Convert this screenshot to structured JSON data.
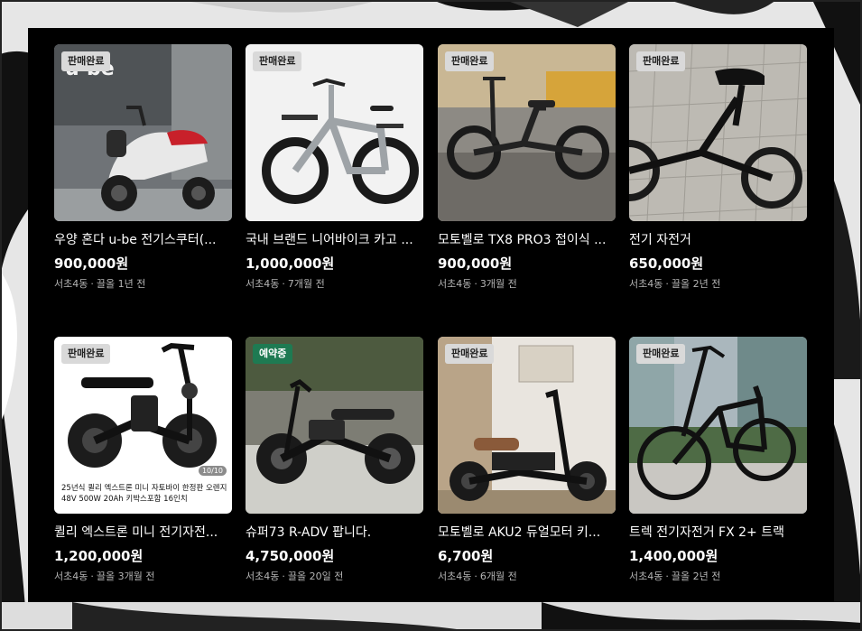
{
  "listings": [
    {
      "badge": "판매완료",
      "badge_type": "sold",
      "title": "우양 혼다 u-be 전기스쿠터(...",
      "price": "900,000원",
      "location": "서초4동",
      "time": "끌올 1년 전"
    },
    {
      "badge": "판매완료",
      "badge_type": "sold",
      "title": "국내 브랜드 니어바이크 카고 ...",
      "price": "1,000,000원",
      "location": "서초4동",
      "time": "7개월 전"
    },
    {
      "badge": "판매완료",
      "badge_type": "sold",
      "title": "모토벨로 TX8 PRO3 접이식 ...",
      "price": "900,000원",
      "location": "서초4동",
      "time": "3개월 전"
    },
    {
      "badge": "판매완료",
      "badge_type": "sold",
      "title": "전기 자전거",
      "price": "650,000원",
      "location": "서초4동",
      "time": "끌올 2년 전"
    },
    {
      "badge": "판매완료",
      "badge_type": "sold",
      "title": "퀼리 엑스트론 미니 전기자전...",
      "price": "1,200,000원",
      "location": "서초4동",
      "time": "끌올 3개월 전",
      "image_caption": "25년식 퀼리 엑스트론 미니 자토바이 한정판 오렌지 48V 500W 20Ah 키박스포함 16인치",
      "image_counter": "10/10"
    },
    {
      "badge": "예약중",
      "badge_type": "reserved",
      "title": "슈퍼73 R-ADV 팝니다.",
      "price": "4,750,000원",
      "location": "서초4동",
      "time": "끌올 20일 전"
    },
    {
      "badge": "판매완료",
      "badge_type": "sold",
      "title": "모토벨로 AKU2 듀얼모터 키...",
      "price": "6,700원",
      "location": "서초4동",
      "time": "6개월 전"
    },
    {
      "badge": "판매완료",
      "badge_type": "sold",
      "title": "트렉 전기자전거 FX 2+ 트랙",
      "price": "1,400,000원",
      "location": "서초4동",
      "time": "끌올 2년 전"
    }
  ],
  "separator": "·",
  "colors": {
    "panel": "#000000",
    "badge_sold": "#d9d9d9",
    "badge_reserved": "#1e7a52",
    "meta_text": "#b5b5b5"
  }
}
